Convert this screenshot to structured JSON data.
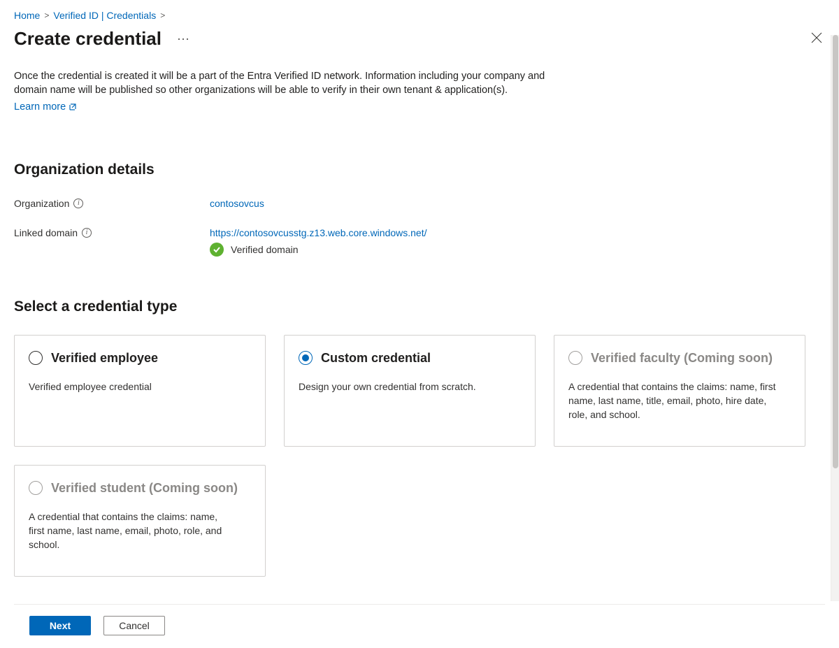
{
  "breadcrumb": {
    "items": [
      {
        "label": "Home"
      },
      {
        "label": "Verified ID | Credentials"
      }
    ]
  },
  "header": {
    "title": "Create credential"
  },
  "intro": {
    "text": "Once the credential is created it will be a part of the Entra Verified ID network. Information including your company and domain name will be published so other organizations will be able to verify in their own tenant & application(s).",
    "learn_more": "Learn more"
  },
  "org_details": {
    "heading": "Organization details",
    "org_label": "Organization",
    "org_value": "contosovcus",
    "domain_label": "Linked domain",
    "domain_url": "https://contosovcusstg.z13.web.core.windows.net/",
    "verified_text": "Verified domain"
  },
  "select_type": {
    "heading": "Select a credential type",
    "cards": [
      {
        "title": "Verified employee",
        "desc": "Verified employee credential",
        "selected": false,
        "disabled": false
      },
      {
        "title": "Custom credential",
        "desc": "Design your own credential from scratch.",
        "selected": true,
        "disabled": false
      },
      {
        "title": "Verified faculty (Coming soon)",
        "desc": "A credential that contains the claims: name, first name, last name, title, email, photo, hire date, role, and school.",
        "selected": false,
        "disabled": true
      },
      {
        "title": "Verified student (Coming soon)",
        "desc": "A credential that contains the claims: name, first name, last name, email, photo, role, and school.",
        "selected": false,
        "disabled": true
      }
    ]
  },
  "footer": {
    "next": "Next",
    "cancel": "Cancel"
  }
}
